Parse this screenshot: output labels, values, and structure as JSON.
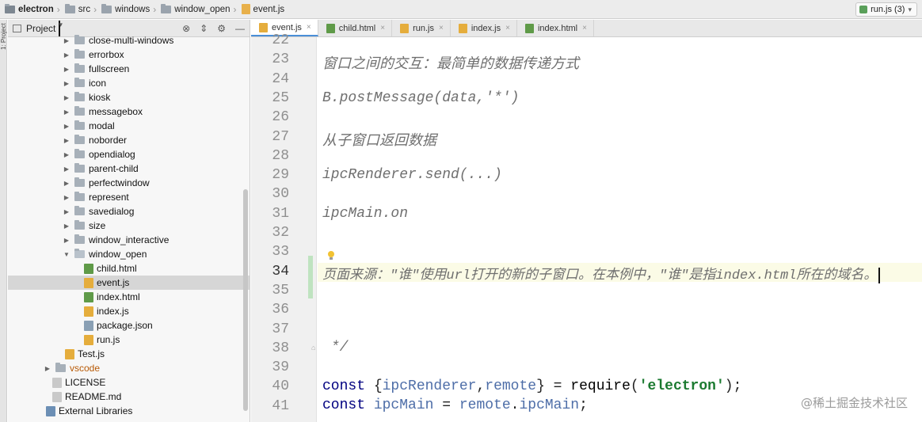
{
  "breadcrumb": [
    {
      "label": "electron",
      "icon": "folder-icon",
      "bold": true
    },
    {
      "label": "src",
      "icon": "folder-icon"
    },
    {
      "label": "windows",
      "icon": "folder-icon"
    },
    {
      "label": "window_open",
      "icon": "folder-icon"
    },
    {
      "label": "event.js",
      "icon": "js-file-icon"
    }
  ],
  "run_config": {
    "label": "run.js (3)"
  },
  "toolstrip": {
    "project_label": "1: Project"
  },
  "project_panel": {
    "title": "Project",
    "tree": [
      {
        "label": "close-multi-windows",
        "type": "folder",
        "indent": 1,
        "expanded": false
      },
      {
        "label": "errorbox",
        "type": "folder",
        "indent": 1,
        "expanded": false
      },
      {
        "label": "fullscreen",
        "type": "folder",
        "indent": 1,
        "expanded": false
      },
      {
        "label": "icon",
        "type": "folder",
        "indent": 1,
        "expanded": false
      },
      {
        "label": "kiosk",
        "type": "folder",
        "indent": 1,
        "expanded": false
      },
      {
        "label": "messagebox",
        "type": "folder",
        "indent": 1,
        "expanded": false
      },
      {
        "label": "modal",
        "type": "folder",
        "indent": 1,
        "expanded": false
      },
      {
        "label": "noborder",
        "type": "folder",
        "indent": 1,
        "expanded": false
      },
      {
        "label": "opendialog",
        "type": "folder",
        "indent": 1,
        "expanded": false
      },
      {
        "label": "parent-child",
        "type": "folder",
        "indent": 1,
        "expanded": false
      },
      {
        "label": "perfectwindow",
        "type": "folder",
        "indent": 1,
        "expanded": false
      },
      {
        "label": "represent",
        "type": "folder",
        "indent": 1,
        "expanded": false
      },
      {
        "label": "savedialog",
        "type": "folder",
        "indent": 1,
        "expanded": false
      },
      {
        "label": "size",
        "type": "folder",
        "indent": 1,
        "expanded": false
      },
      {
        "label": "window_interactive",
        "type": "folder",
        "indent": 1,
        "expanded": false
      },
      {
        "label": "window_open",
        "type": "folder",
        "indent": 1,
        "expanded": true
      },
      {
        "label": "child.html",
        "type": "html",
        "indent": 2
      },
      {
        "label": "event.js",
        "type": "js",
        "indent": 2,
        "selected": true
      },
      {
        "label": "index.html",
        "type": "html",
        "indent": 2
      },
      {
        "label": "index.js",
        "type": "js",
        "indent": 2
      },
      {
        "label": "package.json",
        "type": "json",
        "indent": 2
      },
      {
        "label": "run.js",
        "type": "js",
        "indent": 2
      },
      {
        "label": "Test.js",
        "type": "js",
        "indent": 0.5
      },
      {
        "label": "vscode",
        "type": "folder",
        "indent": -0.5,
        "expanded": false,
        "orange": true
      },
      {
        "label": "LICENSE",
        "type": "txt",
        "indent": -0.5
      },
      {
        "label": "README.md",
        "type": "txt",
        "indent": -0.5
      },
      {
        "label": "External Libraries",
        "type": "lib",
        "indent": -1
      }
    ]
  },
  "tabs": [
    {
      "label": "event.js",
      "icon": "js-file-icon",
      "active": true
    },
    {
      "label": "child.html",
      "icon": "html-file-icon"
    },
    {
      "label": "run.js",
      "icon": "js-file-icon"
    },
    {
      "label": "index.js",
      "icon": "js-file-icon"
    },
    {
      "label": "index.html",
      "icon": "html-file-icon"
    }
  ],
  "editor": {
    "line_numbers": [
      "22",
      "23",
      "24",
      "25",
      "26",
      "27",
      "28",
      "29",
      "30",
      "31",
      "32",
      "33",
      "34",
      "35",
      "36",
      "37",
      "38",
      "39",
      "40",
      "41"
    ],
    "current_line": "34",
    "lines": {
      "l23": "窗口之间的交互：最简单的数据传递方式",
      "l25": "B.postMessage(data,'*')",
      "l27": "从子窗口返回数据",
      "l29": "ipcRenderer.send(...)",
      "l31": "ipcMain.on",
      "l34": "页面来源：\"谁\"使用url打开的新的子窗口。在本例中，\"谁\"是指index.html所在的域名。",
      "l38": " */",
      "l40_kw": "const",
      "l40_a": " {",
      "l40_v1": "ipcRenderer",
      "l40_b": ",",
      "l40_v2": "remote",
      "l40_c": "} = ",
      "l40_fn": "require",
      "l40_d": "(",
      "l40_str": "'electron'",
      "l40_e": ");",
      "l41_kw": "const",
      "l41_v1": " ipcMain",
      "l41_b": " = ",
      "l41_v2": "remote",
      "l41_c": ".",
      "l41_v3": "ipcMain",
      "l41_d": ";"
    }
  },
  "watermark": "@稀土掘金技术社区",
  "colors": {
    "accent": "#4a8fd8",
    "changed_line": "#bfe3c0",
    "current_line_bg": "#fbfbe6"
  }
}
